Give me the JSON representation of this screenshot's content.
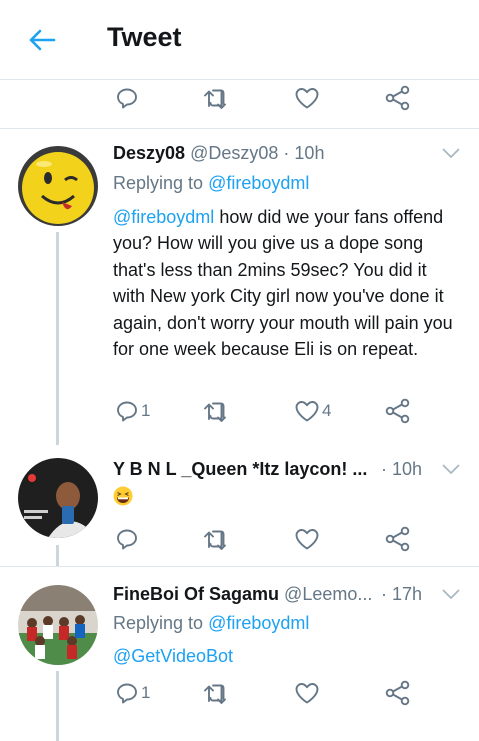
{
  "header": {
    "title": "Tweet"
  },
  "actions_top": {
    "reply_count": "",
    "retweet_count": "",
    "like_count": ""
  },
  "tweets": [
    {
      "name": "Deszy08",
      "handle": "@Deszy08",
      "dot": "·",
      "time": "10h",
      "replying_prefix": "Replying to",
      "replying_to": "@fireboydml",
      "mention": "@fireboydml",
      "text": " how did we your fans offend you? How will you give us a dope song that's less than 2mins 59sec? You did it with New york City girl now you've done it again, don't worry your mouth will pain you for one week because Eli is on repeat.",
      "reply_count": "1",
      "retweet_count": "",
      "like_count": "4"
    },
    {
      "name": "Y B N L _Queen *Itz laycon! ...",
      "handle": "",
      "dot": "·",
      "time": "10h",
      "emoji": "grinning-squinting-face",
      "reply_count": "",
      "retweet_count": "",
      "like_count": ""
    },
    {
      "name": "FineBoi Of Sagamu",
      "handle": "@Leemo...",
      "dot": "·",
      "time": "17h",
      "replying_prefix": "Replying to",
      "replying_to": "@fireboydml",
      "text": "@GetVideoBot",
      "reply_count": "1",
      "retweet_count": "",
      "like_count": ""
    }
  ],
  "colors": {
    "accent": "#1da1f2",
    "secondary_text": "#657786",
    "divider": "#e1e8ed",
    "thread_line": "#ccd6dd"
  }
}
